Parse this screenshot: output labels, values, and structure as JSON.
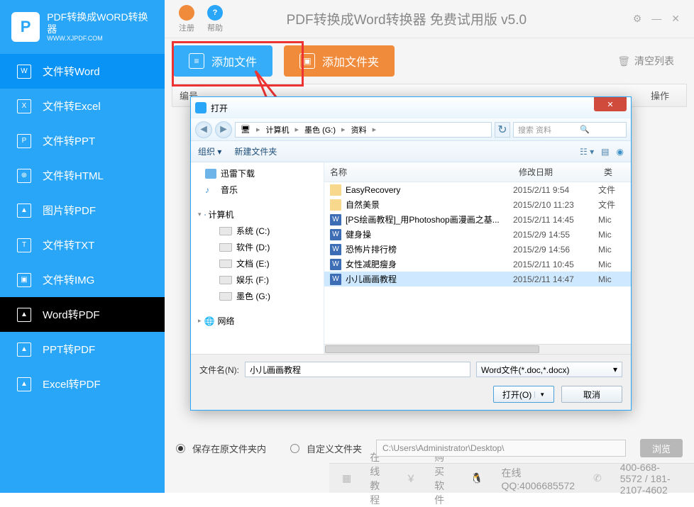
{
  "logo": {
    "title": "PDF转换成WORD转换器",
    "sub": "WWW.XJPDF.COM"
  },
  "nav": [
    {
      "label": "文件转Word",
      "icon": "W"
    },
    {
      "label": "文件转Excel",
      "icon": "X"
    },
    {
      "label": "文件转PPT",
      "icon": "P"
    },
    {
      "label": "文件转HTML",
      "icon": "⊕"
    },
    {
      "label": "图片转PDF",
      "icon": "▲"
    },
    {
      "label": "文件转TXT",
      "icon": "T"
    },
    {
      "label": "文件转IMG",
      "icon": "▣"
    },
    {
      "label": "Word转PDF",
      "icon": "▲"
    },
    {
      "label": "PPT转PDF",
      "icon": "▲"
    },
    {
      "label": "Excel转PDF",
      "icon": "▲"
    }
  ],
  "topbar": {
    "register": "注册",
    "help": "帮助",
    "title": "PDF转换成Word转换器 免费试用版 v5.0"
  },
  "toolbar": {
    "add_file": "添加文件",
    "add_folder": "添加文件夹",
    "clear": "清空列表"
  },
  "table": {
    "col1": "编号",
    "col2": "操作"
  },
  "dialog": {
    "title": "打开",
    "crumbs": [
      "计算机",
      "墨色 (G:)",
      "资料"
    ],
    "search_placeholder": "搜索 资料",
    "organize": "组织 ▾",
    "new_folder": "新建文件夹",
    "tree": {
      "download": "迅雷下载",
      "music": "音乐",
      "computer": "计算机",
      "drives": [
        "系统 (C:)",
        "软件 (D:)",
        "文档 (E:)",
        "娱乐 (F:)",
        "墨色 (G:)"
      ],
      "network": "网络"
    },
    "cols": {
      "name": "名称",
      "date": "修改日期",
      "type": "类"
    },
    "files": [
      {
        "name": "EasyRecovery",
        "date": "2015/2/11 9:54",
        "type": "文件",
        "kind": "folder"
      },
      {
        "name": "自然美景",
        "date": "2015/2/10 11:23",
        "type": "文件",
        "kind": "folder"
      },
      {
        "name": "[PS绘画教程]_用Photoshop画漫画之基...",
        "date": "2015/2/11 14:45",
        "type": "Mic",
        "kind": "wdoc"
      },
      {
        "name": "健身操",
        "date": "2015/2/9 14:55",
        "type": "Mic",
        "kind": "wdoc"
      },
      {
        "name": "恐怖片排行榜",
        "date": "2015/2/9 14:56",
        "type": "Mic",
        "kind": "wdoc"
      },
      {
        "name": "女性减肥瘦身",
        "date": "2015/2/11 10:45",
        "type": "Mic",
        "kind": "wdoc"
      },
      {
        "name": "小儿画画教程",
        "date": "2015/2/11 14:47",
        "type": "Mic",
        "kind": "wdoc"
      }
    ],
    "filename_label": "文件名(N):",
    "filename_value": "小儿画画教程",
    "filetype": "Word文件(*.doc,*.docx)",
    "open_btn": "打开(O)",
    "cancel_btn": "取消"
  },
  "bottom": {
    "opt1": "保存在原文件夹内",
    "opt2": "自定义文件夹",
    "path": "C:\\Users\\Administrator\\Desktop\\",
    "browse": "浏览"
  },
  "footer": {
    "tutorial": "在线教程",
    "buy": "购买软件",
    "qq": "在线QQ:4006685572",
    "phone": "400-668-5572 / 181-2107-4602"
  }
}
